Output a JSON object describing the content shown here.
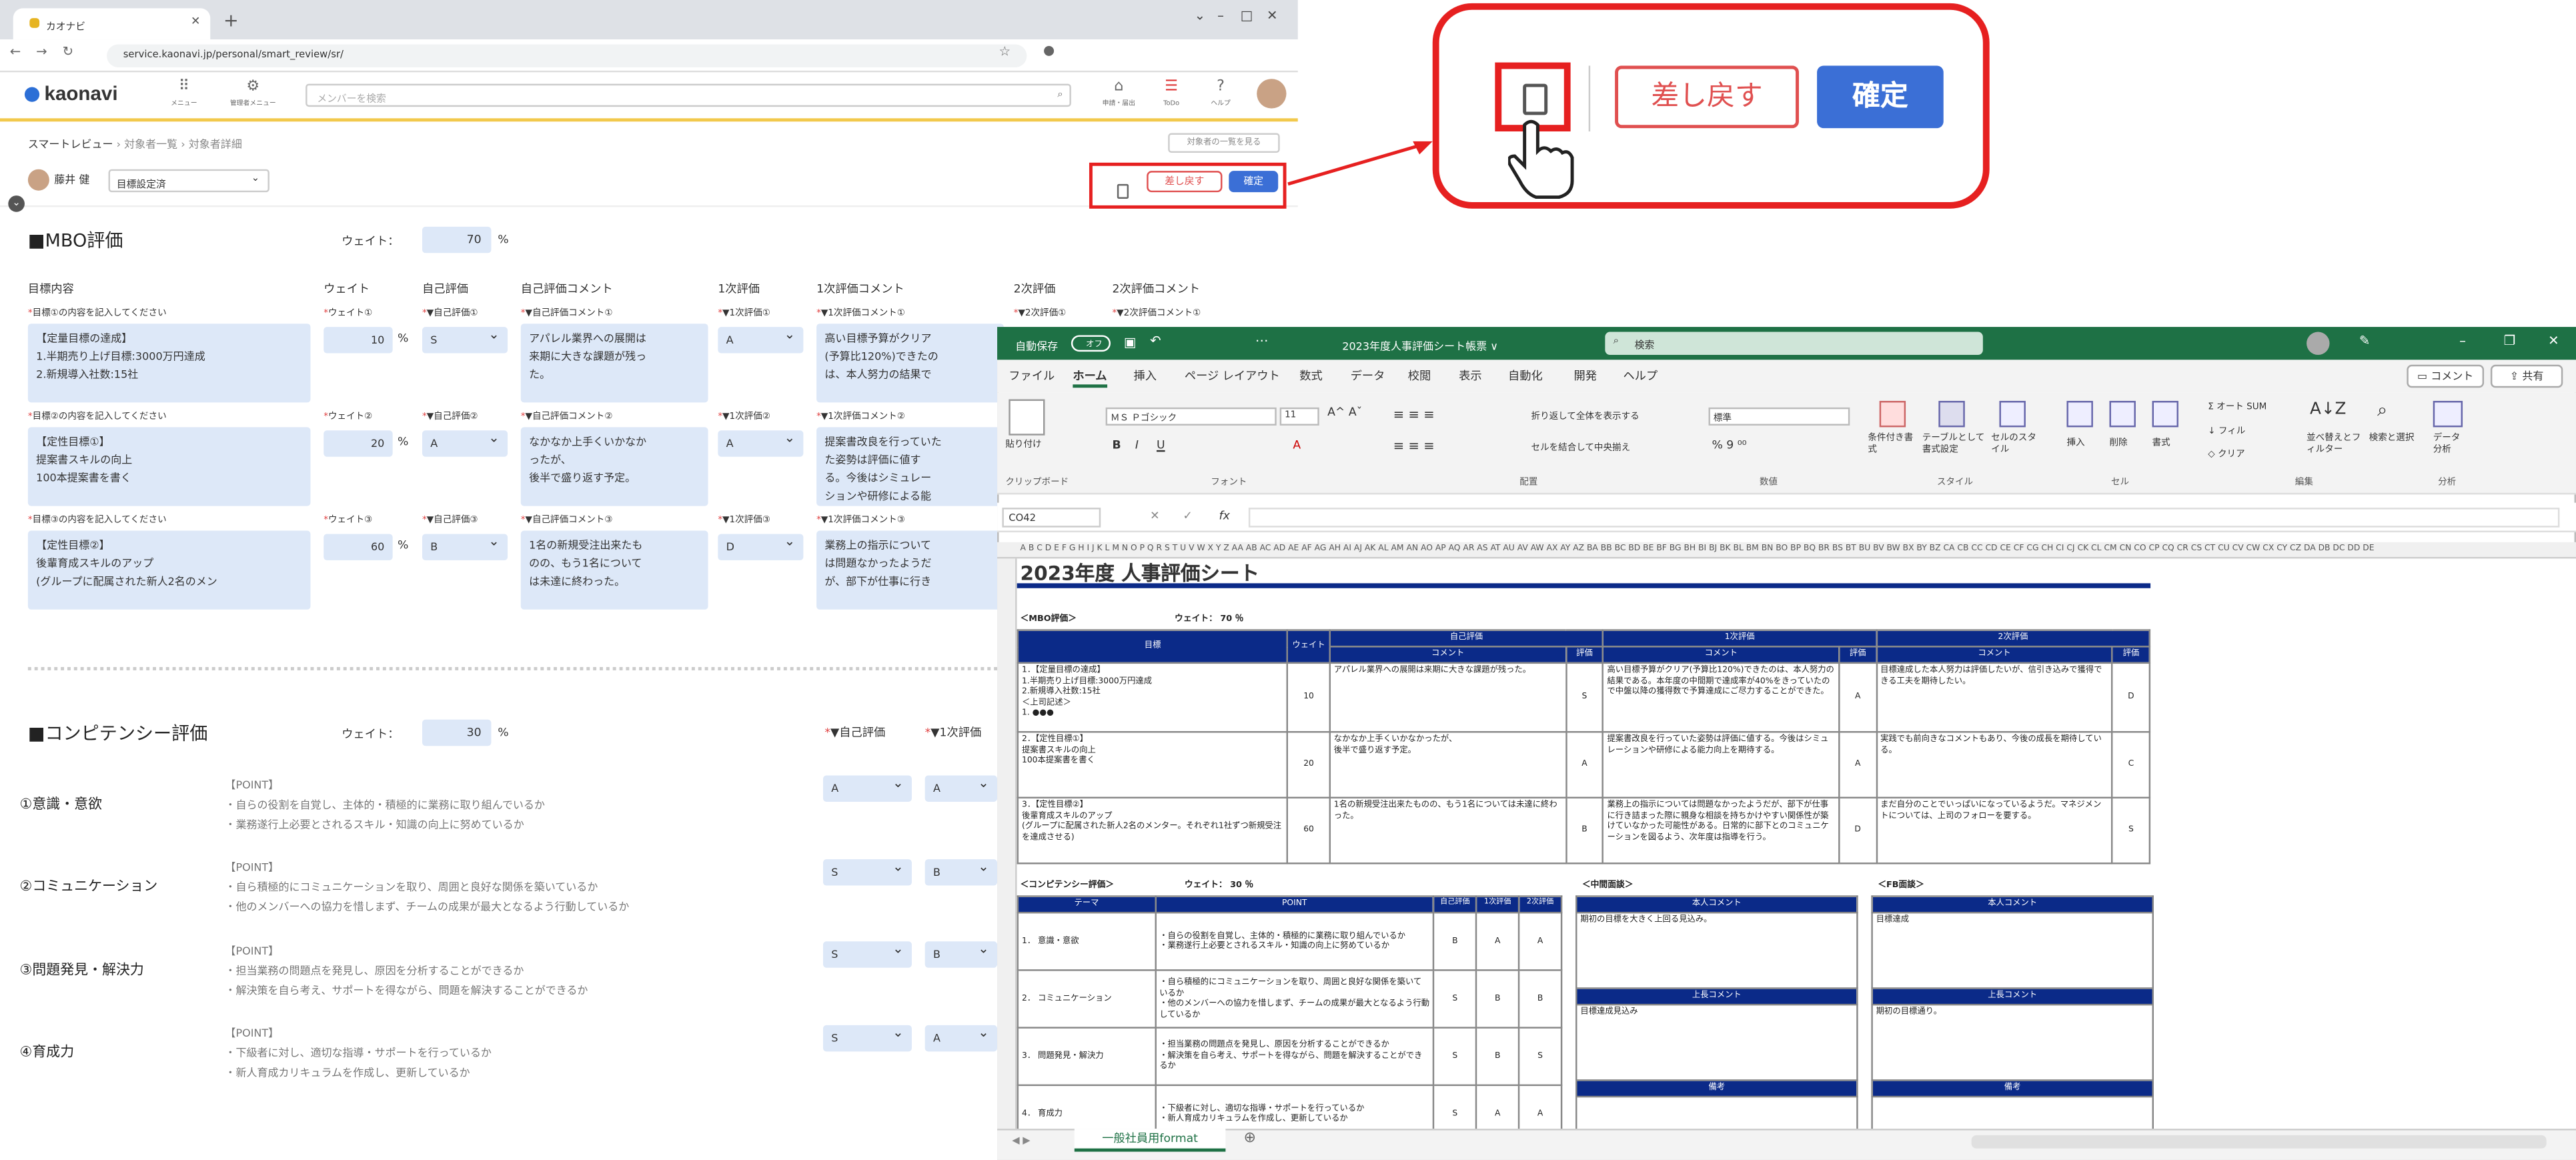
{
  "browser": {
    "tab_title": "カオナビ",
    "url": "service.kaonavi.jp/personal/smart_review/sr/"
  },
  "header": {
    "logo": "kaonavi",
    "menu_label": "メニュー",
    "admin_label": "管理者メニュー",
    "search_placeholder": "メンバーを検索",
    "apply_label": "申請・届出",
    "todo_label": "ToDo",
    "help_label": "ヘルプ"
  },
  "breadcrumb": {
    "root": "スマートレビュー",
    "level1": "対象者一覧",
    "level2": "対象者詳細",
    "back_button": "対象者の一覧を見る"
  },
  "subject": {
    "name": "藤井 健",
    "status": "目標設定済"
  },
  "actions": {
    "return_label": "差し戻す",
    "confirm_label": "確定"
  },
  "mbo": {
    "title": "■MBO評価",
    "weight_label": "ウェイト：",
    "weight_value": "70",
    "percent": "%",
    "headers": {
      "goal": "目標内容",
      "weight": "ウェイト",
      "self": "自己評価",
      "self_comment": "自己評価コメント",
      "first": "1次評価",
      "first_comment": "1次評価コメント",
      "second": "2次評価",
      "second_comment": "2次評価コメント"
    },
    "rows": [
      {
        "goal_req": "目標①の内容を記入してください",
        "goal_text": "【定量目標の達成】\n1.半期売り上げ目標:3000万円達成\n2.新規導入社数:15社",
        "weight_req": "ウェイト①",
        "weight": "10",
        "self_req": "▼自己評価①",
        "self": "S",
        "selfc_req": "▼自己評価コメント①",
        "selfc": "アパレル業界への展開は\n来期に大きな課題が残っ\nた。",
        "first_req": "▼1次評価①",
        "first": "A",
        "firstc_req": "▼1次評価コメント①",
        "firstc": "高い目標予算がクリア\n(予算比120%)できたの\nは、本人努力の結果で",
        "second_req": "▼2次評価①",
        "secondc_req": "▼2次評価コメント①"
      },
      {
        "goal_req": "目標②の内容を記入してください",
        "goal_text": "【定性目標①】\n提案書スキルの向上\n100本提案書を書く",
        "weight_req": "ウェイト②",
        "weight": "20",
        "self_req": "▼自己評価②",
        "self": "A",
        "selfc_req": "▼自己評価コメント②",
        "selfc": "なかなか上手くいかなか\nったが、\n後半で盛り返す予定。",
        "first_req": "▼1次評価②",
        "first": "A",
        "firstc_req": "▼1次評価コメント②",
        "firstc": "提案書改良を行っていた\nた姿勢は評価に値す\nる。今後はシミュレー\nションや研修による能"
      },
      {
        "goal_req": "目標③の内容を記入してください",
        "goal_text": "【定性目標②】\n後輩育成スキルのアップ\n(グループに配属された新人2名のメン",
        "weight_req": "ウェイト③",
        "weight": "60",
        "self_req": "▼自己評価③",
        "self": "B",
        "selfc_req": "▼自己評価コメント③",
        "selfc": "1名の新規受注出来たも\nのの、もう1名について\nは未達に終わった。",
        "first_req": "▼1次評価③",
        "first": "D",
        "firstc_req": "▼1次評価コメント③",
        "firstc": "業務上の指示について\nは問題なかったようだ\nが、部下が仕事に行き"
      }
    ]
  },
  "competency": {
    "title": "■コンピテンシー評価",
    "weight_label": "ウェイト：",
    "weight_value": "30",
    "percent": "%",
    "self_header": "▼自己評価",
    "first_header": "▼1次評価",
    "items": [
      {
        "name": "①意識・意欲",
        "point": "【POINT】",
        "l1": "・自らの役割を自覚し、主体的・積極的に業務に取り組んでいるか",
        "l2": "・業務遂行上必要とされるスキル・知識の向上に努めているか",
        "self": "A",
        "first": "A"
      },
      {
        "name": "②コミュニケーション",
        "point": "【POINT】",
        "l1": "・自ら積極的にコミュニケーションを取り、周囲と良好な関係を築いているか",
        "l2": "・他のメンバーへの協力を惜しまず、チームの成果が最大となるよう行動しているか",
        "self": "S",
        "first": "B"
      },
      {
        "name": "③問題発見・解決力",
        "point": "【POINT】",
        "l1": "・担当業務の問題点を発見し、原因を分析することができるか",
        "l2": "・解決策を自ら考え、サポートを得ながら、問題を解決することができるか",
        "self": "S",
        "first": "B"
      },
      {
        "name": "④育成力",
        "point": "【POINT】",
        "l1": "・下級者に対し、適切な指導・サポートを行っているか",
        "l2": "・新人育成カリキュラムを作成し、更新しているか",
        "self": "S",
        "first": "A"
      }
    ]
  },
  "callout": {
    "return_label": "差し戻す",
    "confirm_label": "確定"
  },
  "excel": {
    "autosave": "自動保存",
    "autosave_state": "オフ",
    "title": "2023年度人事評価シート帳票 ∨",
    "search": "検索",
    "comment_btn": "コメント",
    "share_btn": "共有",
    "menu": [
      "ファイル",
      "ホーム",
      "挿入",
      "ページ レイアウト",
      "数式",
      "データ",
      "校閲",
      "表示",
      "自動化",
      "開発",
      "ヘルプ"
    ],
    "font_name": "ＭＳ Ｐゴシック",
    "font_size": "11",
    "number_format": "標準",
    "ribbon": {
      "paste": "貼り付け",
      "wrap": "折り返して全体を表示する",
      "merge": "セルを結合して中央揃え",
      "cond": "条件付き書式",
      "table": "テーブルとして書式設定",
      "cellstyle": "セルのスタイル",
      "insert": "挿入",
      "delete": "削除",
      "format": "書式",
      "autosum": "オート SUM",
      "fill": "フィル",
      "clear": "クリア",
      "sort": "並べ替えとフィルター",
      "find": "検索と選択",
      "analyze": "データ分析"
    },
    "groups": [
      "クリップボード",
      "フォント",
      "配置",
      "数値",
      "スタイル",
      "セル",
      "編集",
      "分析"
    ],
    "cell_ref": "CO42",
    "fx": "fx",
    "col_letters": "A B C D E F G H I J K L M N O P Q R S T U V W X Y Z AA AB AC AD AE AF AG AH AI AJ AK AL AM AN AO AP AQ AR AS AT AU AV AW AX AY AZ BA BB BC BD BE BF BG BH BI BJ BK BL BM BN BO BP BQ BR BS BT BU BV BW BX BY BZ CA CB CC CD CE CF CG CH CI CJ CK CL CM CN CO CP CQ CR CS CT CU CV CW CX CY CZ DA DB DC DD DE",
    "sheet_title": "2023年度 人事評価シート",
    "mbo_label": "＜MBO評価＞",
    "mbo_weight": "ウェイト： 70 ％",
    "h_goal": "目標",
    "h_weight": "ウェイト",
    "h_self": "自己評価",
    "h_first": "1次評価",
    "h_second": "2次評価",
    "h_comment": "コメント",
    "h_eval": "評価",
    "rows": [
      {
        "goal": "1．【定量目標の達成】\n1.半期売り上げ目標:3000万円達成\n2.新規導入社数:15社\n＜上司記述＞\n1.  ●●●",
        "w": "10",
        "selfc": "アパレル業界への展開は来期に大きな課題が残った。",
        "self": "S",
        "firstc": "高い目標予算がクリア(予算比120%)できたのは、本人努力の結果である。本年度の中間期で達成率が40%をきっていたので中盤以降の獲得数で予算達成にご尽力することができた。",
        "first": "A",
        "secondc": "目標達成した本人努力は評価したいが、信引き込みで獲得できる工夫を期待したい。",
        "second": "D"
      },
      {
        "goal": "2．【定性目標①】\n提案書スキルの向上\n100本提案書を書く",
        "w": "20",
        "selfc": "なかなか上手くいかなかったが、\n後半で盛り返す予定。",
        "self": "A",
        "firstc": "提案書改良を行っていた姿勢は評価に値する。今後はシミュレーションや研修による能力向上を期待する。",
        "first": "A",
        "secondc": "実践でも前向きなコメントもあり、今後の成長を期待している。",
        "second": "C"
      },
      {
        "goal": "3．【定性目標②】\n後輩育成スキルのアップ\n(グループに配属された新人2名のメンター。それぞれ1社ずつ新規受注を達成させる)",
        "w": "60",
        "selfc": "1名の新規受注出来たものの、もう1名については未達に終わった。",
        "self": "B",
        "firstc": "業務上の指示については問題なかったようだが、部下が仕事に行き詰まった際に親身な相談を持ちかけやすい関係性が築けていなかった可能性がある。日常的に部下とのコミュニケーションを図るよう、次年度は指導を行う。",
        "first": "D",
        "secondc": "まだ自分のことでいっぱいになっているようだ。マネジメントについては、上司のフォローを要する。",
        "second": "S"
      }
    ],
    "comp_label": "＜コンピテンシー評価＞",
    "comp_weight": "ウェイト： 30 ％",
    "h_theme": "テーマ",
    "h_point": "POINT",
    "comp_rows": [
      {
        "theme": "1．  意識・意欲",
        "point": "・自らの役割を自覚し、主体的・積極的に業務に取り組んでいるか\n・業務遂行上必要とされるスキル・知識の向上に努めているか",
        "a": "B",
        "b": "A",
        "c": "A"
      },
      {
        "theme": "2．  コミュニケーション",
        "point": "・自ら積極的にコミュニケーションを取り、周囲と良好な関係を築いているか\n・他のメンバーへの協力を惜しまず、チームの成果が最大となるよう行動しているか",
        "a": "S",
        "b": "B",
        "c": "B"
      },
      {
        "theme": "3．  問題発見・解決力",
        "point": "・担当業務の問題点を発見し、原因を分析することができるか\n・解決策を自ら考え、サポートを得ながら、問題を解決することができるか",
        "a": "S",
        "b": "B",
        "c": "S"
      },
      {
        "theme": "4．  育成力",
        "point": "・下級者に対し、適切な指導・サポートを行っているか\n・新人育成カリキュラムを作成し、更新しているか",
        "a": "S",
        "b": "A",
        "c": "A"
      }
    ],
    "mid_label": "＜中間面談＞",
    "fb_label": "＜FB面談＞",
    "h_self_comment": "本人コメント",
    "h_boss_comment": "上長コメント",
    "h_note": "備考",
    "mid_self": "期初の目標を大きく上回る見込み。",
    "mid_boss": "目標達成見込み",
    "fb_self": "目標達成",
    "fb_boss": "期初の目標通り。",
    "sheet_tab": "一般社員用format"
  }
}
